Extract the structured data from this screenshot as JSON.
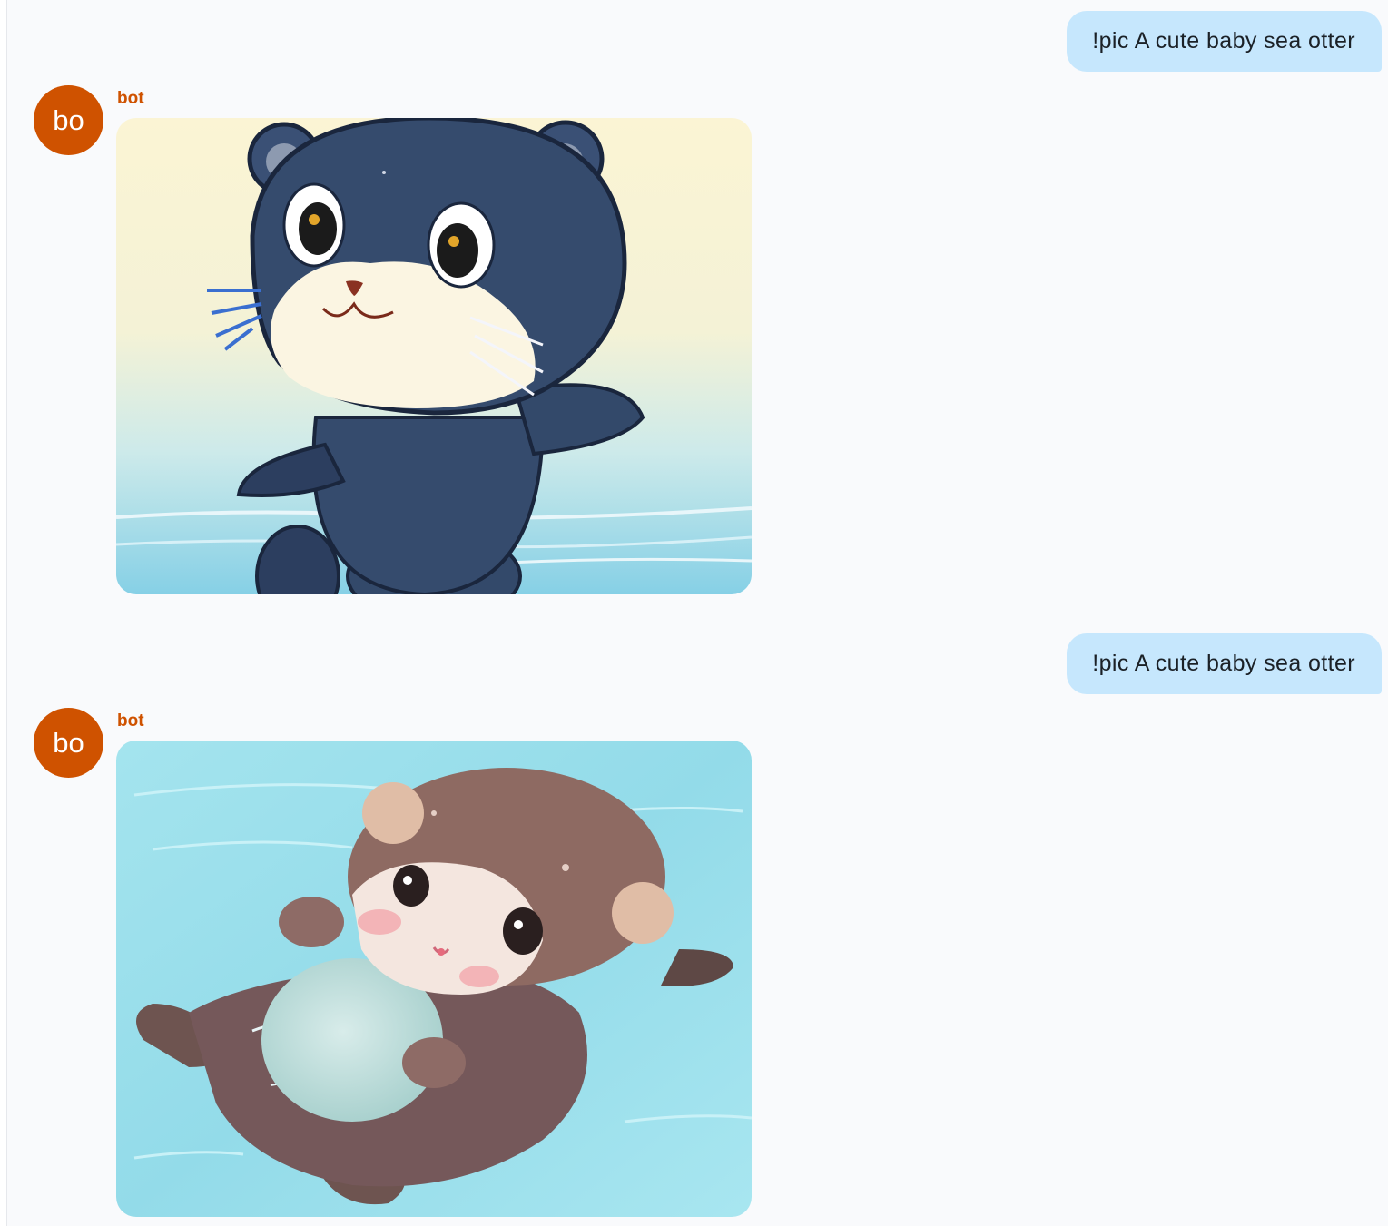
{
  "theme": {
    "bot_color": "#cf5200",
    "user_bubble_color": "#c6e7fd"
  },
  "messages": [
    {
      "role": "user",
      "text": "!pic A cute baby sea otter"
    },
    {
      "role": "bot",
      "sender": "bot",
      "avatar_initials": "bo",
      "attachment": "generated-image-dark-blue-cartoon-otter"
    },
    {
      "role": "user",
      "text": "!pic A cute baby sea otter"
    },
    {
      "role": "bot",
      "sender": "bot",
      "avatar_initials": "bo",
      "attachment": "generated-image-brown-otter-floating"
    }
  ]
}
